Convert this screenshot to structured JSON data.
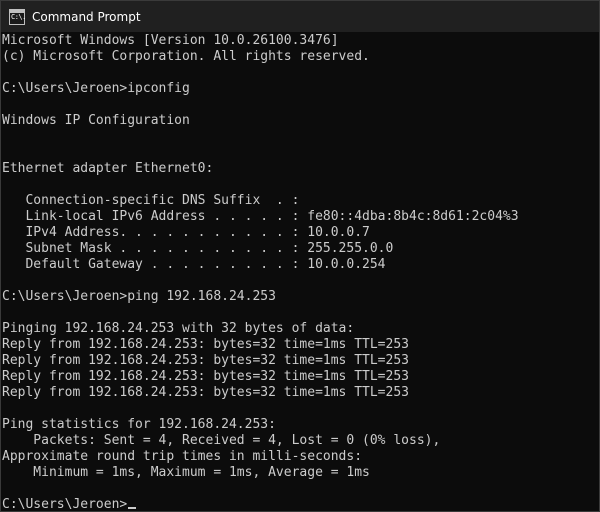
{
  "window": {
    "title": "Command Prompt",
    "icon": "command-prompt-icon",
    "icon_glyph": "C:\\."
  },
  "colors": {
    "background": "#0c0c0c",
    "text": "#cccccc",
    "titlebar": "#202020"
  },
  "console": {
    "lines": [
      "Microsoft Windows [Version 10.0.26100.3476]",
      "(c) Microsoft Corporation. All rights reserved.",
      "",
      "C:\\Users\\Jeroen>ipconfig",
      "",
      "Windows IP Configuration",
      "",
      "",
      "Ethernet adapter Ethernet0:",
      "",
      "   Connection-specific DNS Suffix  . :",
      "   Link-local IPv6 Address . . . . . : fe80::4dba:8b4c:8d61:2c04%3",
      "   IPv4 Address. . . . . . . . . . . : 10.0.0.7",
      "   Subnet Mask . . . . . . . . . . . : 255.255.0.0",
      "   Default Gateway . . . . . . . . . : 10.0.0.254",
      "",
      "C:\\Users\\Jeroen>ping 192.168.24.253",
      "",
      "Pinging 192.168.24.253 with 32 bytes of data:",
      "Reply from 192.168.24.253: bytes=32 time=1ms TTL=253",
      "Reply from 192.168.24.253: bytes=32 time=1ms TTL=253",
      "Reply from 192.168.24.253: bytes=32 time=1ms TTL=253",
      "Reply from 192.168.24.253: bytes=32 time=1ms TTL=253",
      "",
      "Ping statistics for 192.168.24.253:",
      "    Packets: Sent = 4, Received = 4, Lost = 0 (0% loss),",
      "Approximate round trip times in milli-seconds:",
      "    Minimum = 1ms, Maximum = 1ms, Average = 1ms",
      "",
      "C:\\Users\\Jeroen>"
    ]
  }
}
